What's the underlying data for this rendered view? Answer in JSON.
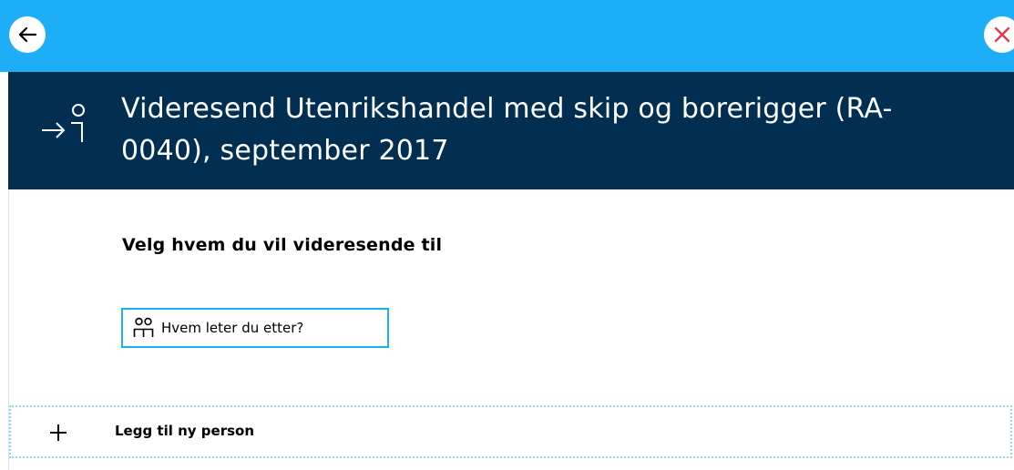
{
  "topbar": {
    "back_icon": "arrow-left-icon",
    "close_icon": "close-x-icon",
    "background_color": "#1eaef7",
    "close_color": "#e23b53"
  },
  "dialog": {
    "icon": "forward-person-icon",
    "title": "Videresend Utenrikshandel med skip og borerigger (RA-0040), september 2017",
    "header_color": "#022f51",
    "section_label": "Velg hvem du vil videresende til",
    "search": {
      "icon": "people-icon",
      "placeholder": "Hvem leter du etter?",
      "value": ""
    },
    "add_person": {
      "icon": "plus-icon",
      "label": "Legg til ny person"
    }
  }
}
